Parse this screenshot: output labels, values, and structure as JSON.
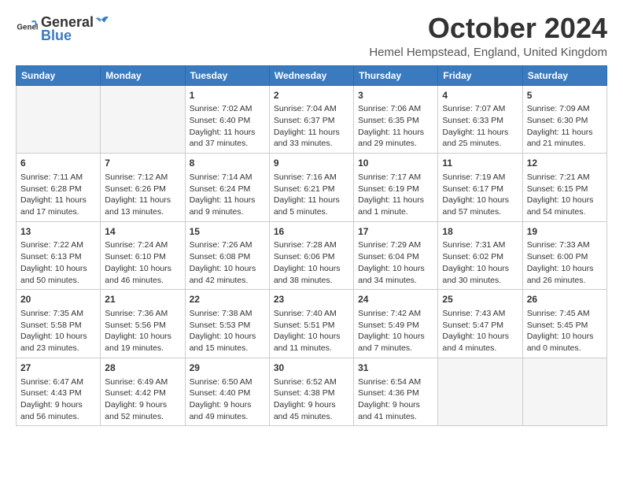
{
  "logo": {
    "general": "General",
    "blue": "Blue"
  },
  "title": "October 2024",
  "location": "Hemel Hempstead, England, United Kingdom",
  "days_of_week": [
    "Sunday",
    "Monday",
    "Tuesday",
    "Wednesday",
    "Thursday",
    "Friday",
    "Saturday"
  ],
  "weeks": [
    [
      {
        "day": "",
        "info": ""
      },
      {
        "day": "",
        "info": ""
      },
      {
        "day": "1",
        "info": "Sunrise: 7:02 AM\nSunset: 6:40 PM\nDaylight: 11 hours and 37 minutes."
      },
      {
        "day": "2",
        "info": "Sunrise: 7:04 AM\nSunset: 6:37 PM\nDaylight: 11 hours and 33 minutes."
      },
      {
        "day": "3",
        "info": "Sunrise: 7:06 AM\nSunset: 6:35 PM\nDaylight: 11 hours and 29 minutes."
      },
      {
        "day": "4",
        "info": "Sunrise: 7:07 AM\nSunset: 6:33 PM\nDaylight: 11 hours and 25 minutes."
      },
      {
        "day": "5",
        "info": "Sunrise: 7:09 AM\nSunset: 6:30 PM\nDaylight: 11 hours and 21 minutes."
      }
    ],
    [
      {
        "day": "6",
        "info": "Sunrise: 7:11 AM\nSunset: 6:28 PM\nDaylight: 11 hours and 17 minutes."
      },
      {
        "day": "7",
        "info": "Sunrise: 7:12 AM\nSunset: 6:26 PM\nDaylight: 11 hours and 13 minutes."
      },
      {
        "day": "8",
        "info": "Sunrise: 7:14 AM\nSunset: 6:24 PM\nDaylight: 11 hours and 9 minutes."
      },
      {
        "day": "9",
        "info": "Sunrise: 7:16 AM\nSunset: 6:21 PM\nDaylight: 11 hours and 5 minutes."
      },
      {
        "day": "10",
        "info": "Sunrise: 7:17 AM\nSunset: 6:19 PM\nDaylight: 11 hours and 1 minute."
      },
      {
        "day": "11",
        "info": "Sunrise: 7:19 AM\nSunset: 6:17 PM\nDaylight: 10 hours and 57 minutes."
      },
      {
        "day": "12",
        "info": "Sunrise: 7:21 AM\nSunset: 6:15 PM\nDaylight: 10 hours and 54 minutes."
      }
    ],
    [
      {
        "day": "13",
        "info": "Sunrise: 7:22 AM\nSunset: 6:13 PM\nDaylight: 10 hours and 50 minutes."
      },
      {
        "day": "14",
        "info": "Sunrise: 7:24 AM\nSunset: 6:10 PM\nDaylight: 10 hours and 46 minutes."
      },
      {
        "day": "15",
        "info": "Sunrise: 7:26 AM\nSunset: 6:08 PM\nDaylight: 10 hours and 42 minutes."
      },
      {
        "day": "16",
        "info": "Sunrise: 7:28 AM\nSunset: 6:06 PM\nDaylight: 10 hours and 38 minutes."
      },
      {
        "day": "17",
        "info": "Sunrise: 7:29 AM\nSunset: 6:04 PM\nDaylight: 10 hours and 34 minutes."
      },
      {
        "day": "18",
        "info": "Sunrise: 7:31 AM\nSunset: 6:02 PM\nDaylight: 10 hours and 30 minutes."
      },
      {
        "day": "19",
        "info": "Sunrise: 7:33 AM\nSunset: 6:00 PM\nDaylight: 10 hours and 26 minutes."
      }
    ],
    [
      {
        "day": "20",
        "info": "Sunrise: 7:35 AM\nSunset: 5:58 PM\nDaylight: 10 hours and 23 minutes."
      },
      {
        "day": "21",
        "info": "Sunrise: 7:36 AM\nSunset: 5:56 PM\nDaylight: 10 hours and 19 minutes."
      },
      {
        "day": "22",
        "info": "Sunrise: 7:38 AM\nSunset: 5:53 PM\nDaylight: 10 hours and 15 minutes."
      },
      {
        "day": "23",
        "info": "Sunrise: 7:40 AM\nSunset: 5:51 PM\nDaylight: 10 hours and 11 minutes."
      },
      {
        "day": "24",
        "info": "Sunrise: 7:42 AM\nSunset: 5:49 PM\nDaylight: 10 hours and 7 minutes."
      },
      {
        "day": "25",
        "info": "Sunrise: 7:43 AM\nSunset: 5:47 PM\nDaylight: 10 hours and 4 minutes."
      },
      {
        "day": "26",
        "info": "Sunrise: 7:45 AM\nSunset: 5:45 PM\nDaylight: 10 hours and 0 minutes."
      }
    ],
    [
      {
        "day": "27",
        "info": "Sunrise: 6:47 AM\nSunset: 4:43 PM\nDaylight: 9 hours and 56 minutes."
      },
      {
        "day": "28",
        "info": "Sunrise: 6:49 AM\nSunset: 4:42 PM\nDaylight: 9 hours and 52 minutes."
      },
      {
        "day": "29",
        "info": "Sunrise: 6:50 AM\nSunset: 4:40 PM\nDaylight: 9 hours and 49 minutes."
      },
      {
        "day": "30",
        "info": "Sunrise: 6:52 AM\nSunset: 4:38 PM\nDaylight: 9 hours and 45 minutes."
      },
      {
        "day": "31",
        "info": "Sunrise: 6:54 AM\nSunset: 4:36 PM\nDaylight: 9 hours and 41 minutes."
      },
      {
        "day": "",
        "info": ""
      },
      {
        "day": "",
        "info": ""
      }
    ]
  ]
}
